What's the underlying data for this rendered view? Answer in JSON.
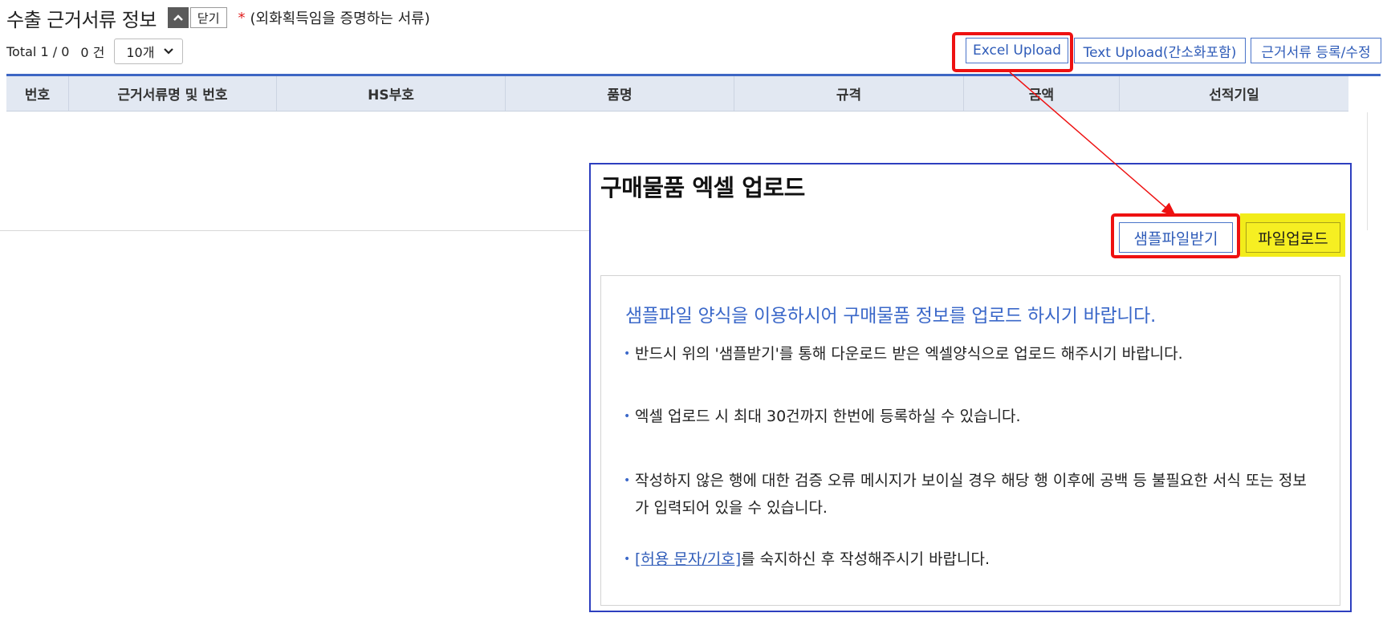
{
  "section": {
    "title": "수출 근거서류 정보",
    "close_label": "닫기",
    "required_mark": "*",
    "required_note": "(외화획득임을 증명하는 서류)"
  },
  "counts": {
    "total_label": "Total 1 / 0",
    "count_label": "0 건",
    "page_size": "10개"
  },
  "toolbar": {
    "excel_upload": "Excel Upload",
    "text_upload": "Text Upload(간소화포함)",
    "register_edit": "근거서류 등록/수정"
  },
  "table": {
    "columns": [
      "번호",
      "근거서류명 및 번호",
      "HS부호",
      "품명",
      "규격",
      "금액",
      "선적기일"
    ]
  },
  "popup": {
    "title": "구매물품 엑셀 업로드",
    "sample_button": "샘플파일받기",
    "upload_button": "파일업로드",
    "info_heading": "샘플파일 양식을 이용하시어 구매물품 정보를 업로드 하시기 바랍니다.",
    "bullets": [
      "반드시 위의 '샘플받기'를 통해 다운로드 받은 엑셀양식으로 업로드 해주시기 바랍니다.",
      "엑셀 업로드 시 최대 30건까지 한번에 등록하실 수 있습니다.",
      "작성하지 않은 행에 대한 검증 오류 메시지가 보이실 경우 해당 행 이후에 공백 등 불필요한 서식 또는 정보가 입력되어 있을 수 있습니다."
    ],
    "last_bullet_link": "[허용 문자/기호]",
    "last_bullet_rest": "를 숙지하신 후 작성해주시기 바랍니다."
  },
  "colors": {
    "accent_blue": "#2e5bb8",
    "highlight_red": "#ee1111",
    "highlight_yellow": "#f2ec1a",
    "header_bg": "#e2e8f2"
  },
  "icons": {
    "toggle": "chevron-up-icon",
    "select": "chevron-down-icon"
  }
}
